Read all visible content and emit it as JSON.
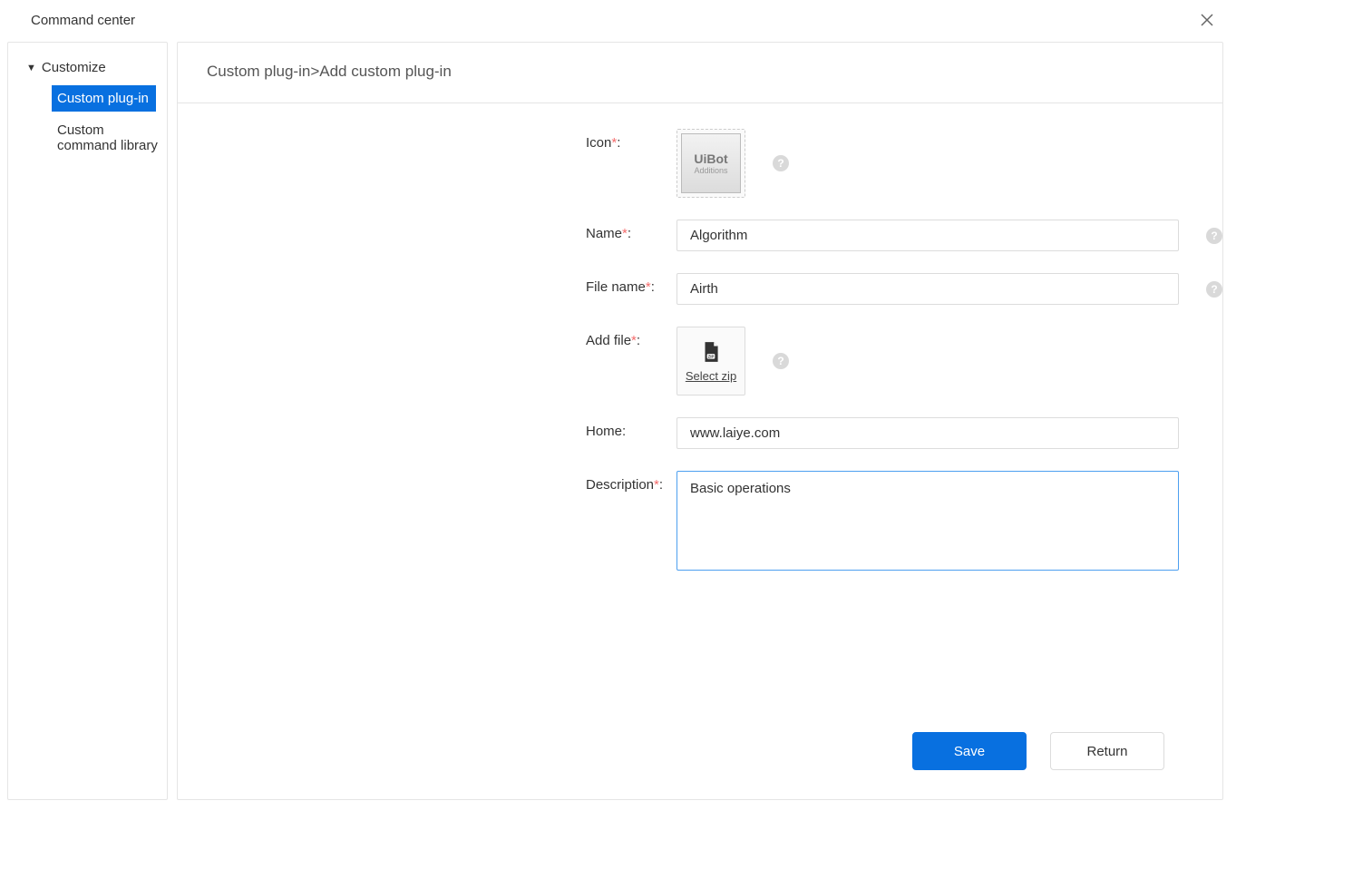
{
  "window": {
    "title": "Command center"
  },
  "sidebar": {
    "parent": "Customize",
    "items": [
      {
        "label": "Custom plug-in",
        "active": true
      },
      {
        "label": "Custom command library",
        "active": false
      }
    ]
  },
  "breadcrumb": {
    "parent": "Custom plug-in",
    "current": "Add custom plug-in"
  },
  "form": {
    "labels": {
      "icon": "Icon",
      "name": "Name",
      "filename": "File name",
      "addfile": "Add file",
      "home": "Home",
      "description": "Description"
    },
    "colon": ":",
    "icon_brand_line1": "UiBot",
    "icon_brand_line2": "Additions",
    "select_zip": "Select zip",
    "values": {
      "name": "Algorithm",
      "filename": "Airth",
      "home": "www.laiye.com",
      "description": "Basic operations"
    }
  },
  "buttons": {
    "save": "Save",
    "return": "Return"
  }
}
